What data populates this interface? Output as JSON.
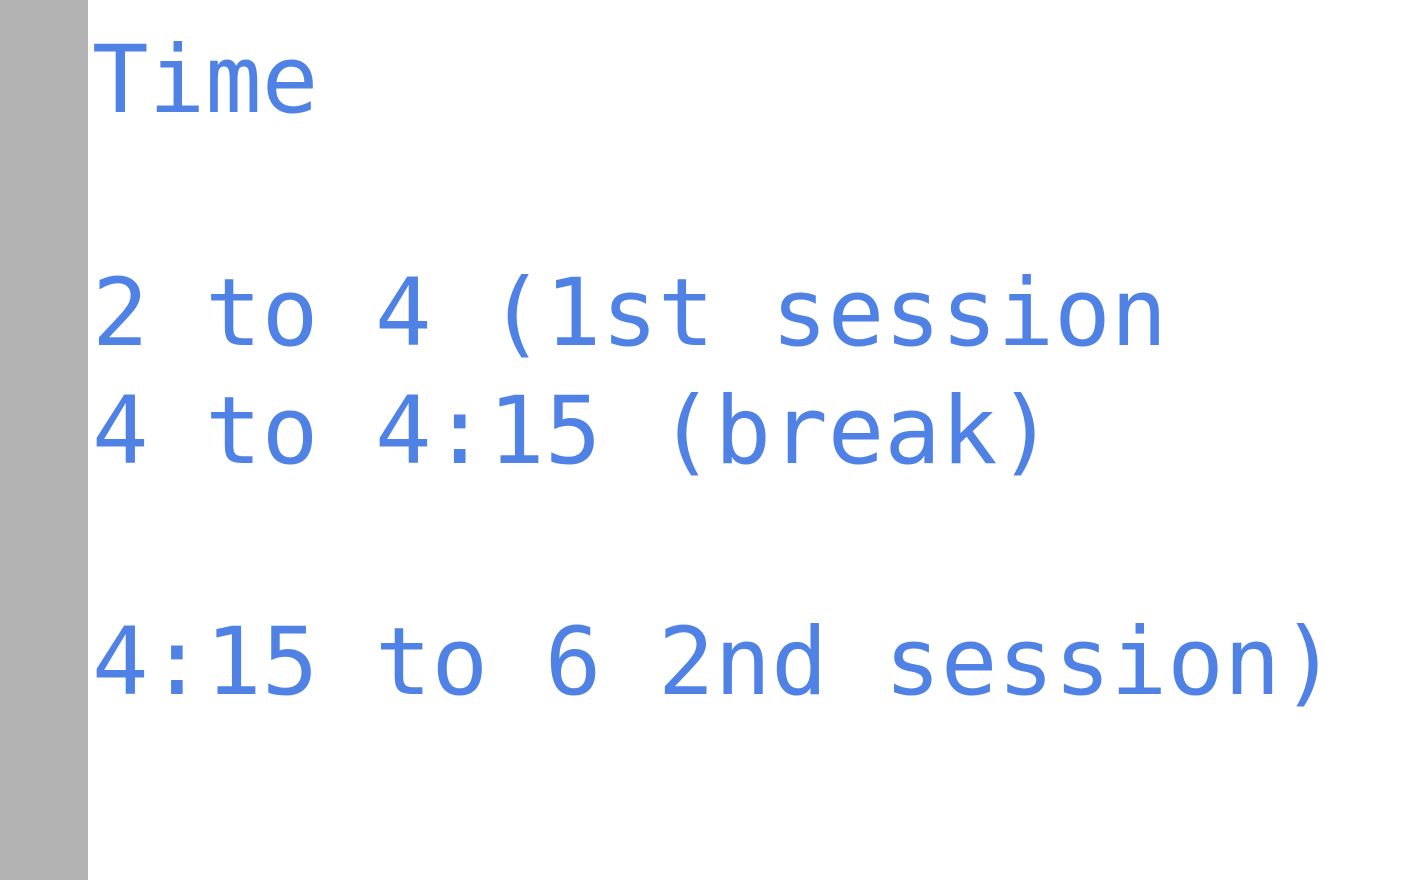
{
  "colors": {
    "text": "#5082e6",
    "gutter": "#b3b3b3",
    "background": "#ffffff"
  },
  "document": {
    "lines": [
      "Time",
      "2 to 4 (1st session",
      "4 to 4:15 (break)",
      "4:15 to 6 2nd session)"
    ]
  }
}
